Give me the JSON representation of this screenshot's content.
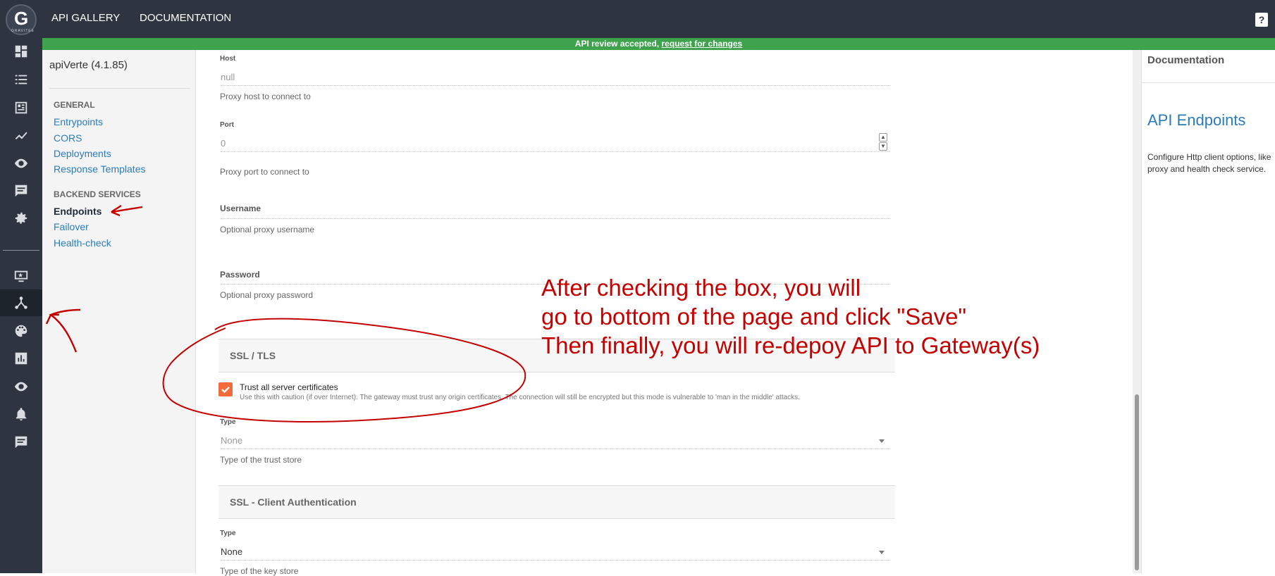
{
  "topbar": {
    "logo_text": "GRAVITEE",
    "links": [
      "API GALLERY",
      "DOCUMENTATION"
    ],
    "help_glyph": "?"
  },
  "rail": {
    "icons": [
      "dashboard-icon",
      "list-icon",
      "catalog-icon",
      "analytics-icon",
      "eye-icon",
      "messages-icon",
      "settings-icon",
      "portal-icon",
      "api-icon",
      "theme-icon",
      "chart-icon",
      "eye-icon",
      "bell-icon",
      "messages-icon"
    ],
    "active": "api-icon"
  },
  "banner": {
    "text": "API review accepted, ",
    "link": "request for changes",
    "color": "#3fa34d"
  },
  "leftnav": {
    "api_title": "apiVerte (4.1.85)",
    "general_header": "GENERAL",
    "general_items": [
      "Entrypoints",
      "CORS",
      "Deployments",
      "Response Templates"
    ],
    "backend_header": "BACKEND SERVICES",
    "backend_items": [
      "Endpoints",
      "Failover",
      "Health-check"
    ],
    "current": "Endpoints"
  },
  "form": {
    "host_label": "Host",
    "host_value": "null",
    "host_help": "Proxy host to connect to",
    "port_label": "Port",
    "port_value": "0",
    "port_help": "Proxy port to connect to",
    "username_label": "Username",
    "username_help": "Optional proxy username",
    "password_label": "Password",
    "password_help": "Optional proxy password",
    "ssl_section": "SSL / TLS",
    "trust_all_label": "Trust all server certificates",
    "trust_all_help": "Use this with caution (if over Internet). The gateway must trust any origin certificates. The connection will still be encrypted but this mode is vulnerable to 'man in the middle' attacks.",
    "trust_all_checked": true,
    "truststore_type_label": "Type",
    "truststore_type_value": "None",
    "truststore_help": "Type of the trust store",
    "client_auth_section": "SSL - Client Authentication",
    "keystore_type_label": "Type",
    "keystore_type_value": "None",
    "keystore_help": "Type of the key store"
  },
  "docpanel": {
    "title": "Documentation",
    "heading": "API Endpoints",
    "text": "Configure Http client options, like proxy and health check service."
  },
  "annotation": {
    "lines": [
      "After checking the box, you will",
      "go to bottom of the page and click \"Save\"",
      "Then finally, you will re-depoy API to Gateway(s)"
    ],
    "color": "#c40000"
  }
}
